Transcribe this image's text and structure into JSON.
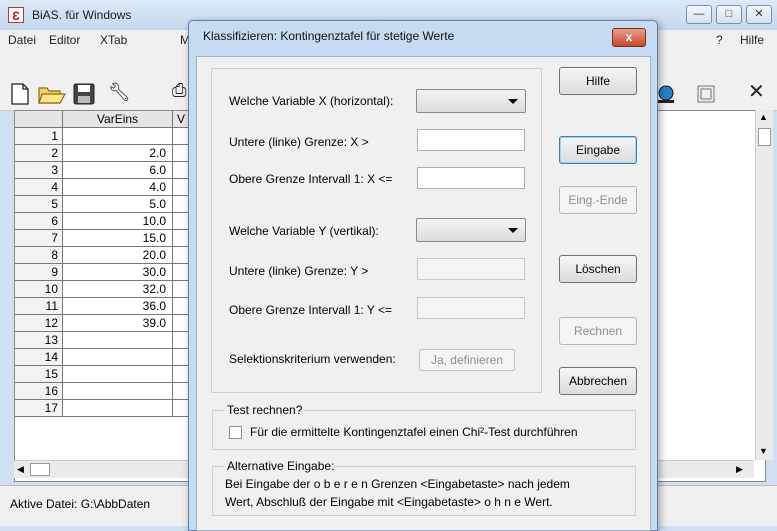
{
  "main_window": {
    "app_icon": "Ɛ",
    "title": "BiAS. für Windows",
    "min_icon": "—",
    "max_icon": "□",
    "close_icon": "✕",
    "menus": [
      "Datei",
      "Editor",
      "XTab",
      "M"
    ],
    "menu_right": [
      "?",
      "Hilfe"
    ],
    "toolbar_icons": [
      "new-doc-icon",
      "open-folder-icon",
      "save-icon",
      "tool-icon",
      "print-icon",
      "globe-icon",
      "window-icon",
      "close-icon"
    ],
    "grid": {
      "column_header": "VarEins",
      "column_header2": "V",
      "rows": [
        {
          "num": "1",
          "value": ""
        },
        {
          "num": "2",
          "value": "2.0"
        },
        {
          "num": "3",
          "value": "6.0"
        },
        {
          "num": "4",
          "value": "4.0"
        },
        {
          "num": "5",
          "value": "5.0"
        },
        {
          "num": "6",
          "value": "10.0"
        },
        {
          "num": "7",
          "value": "15.0"
        },
        {
          "num": "8",
          "value": "20.0"
        },
        {
          "num": "9",
          "value": "30.0"
        },
        {
          "num": "10",
          "value": "32.0"
        },
        {
          "num": "11",
          "value": "36.0"
        },
        {
          "num": "12",
          "value": "39.0"
        },
        {
          "num": "13",
          "value": ""
        },
        {
          "num": "14",
          "value": ""
        },
        {
          "num": "15",
          "value": ""
        },
        {
          "num": "16",
          "value": ""
        },
        {
          "num": "17",
          "value": ""
        }
      ]
    },
    "status": "Aktive Datei: G:\\AbbDaten"
  },
  "dialog": {
    "title": "Klassifizieren: Kontingenztafel für stetige Werte",
    "close_glyph": "x",
    "labels": {
      "var_x": "Welche Variable X (horizontal):",
      "lower_x": "Untere (linke) Grenze:   X  >",
      "upper_x": "Obere Grenze Intervall 1: X <=",
      "var_y": "Welche Variable Y (vertikal):",
      "lower_y": "Untere (linke) Grenze:   Y  >",
      "upper_y": "Obere Grenze Intervall 1: Y <=",
      "selection": "Selektionskriterium verwenden:"
    },
    "buttons": {
      "help": "Hilfe",
      "input": "Eingabe",
      "input_end": "Eing.-Ende",
      "delete": "Löschen",
      "compute": "Rechnen",
      "cancel": "Abbrechen",
      "define": "Ja, definieren"
    },
    "test_group": {
      "title": "Test rechnen?",
      "checkbox_label": "Für die ermittelte Kontingenztafel einen Chi²-Test durchführen",
      "checked": false
    },
    "alt_group": {
      "title": "Alternative Eingabe:",
      "line1": "Bei Eingabe der  o b e r e n  Grenzen  <Eingabetaste>  nach  jedem",
      "line2": "Wert,  Abschluß der Eingabe mit  <Eingabetaste>  o h n e  Wert."
    }
  }
}
